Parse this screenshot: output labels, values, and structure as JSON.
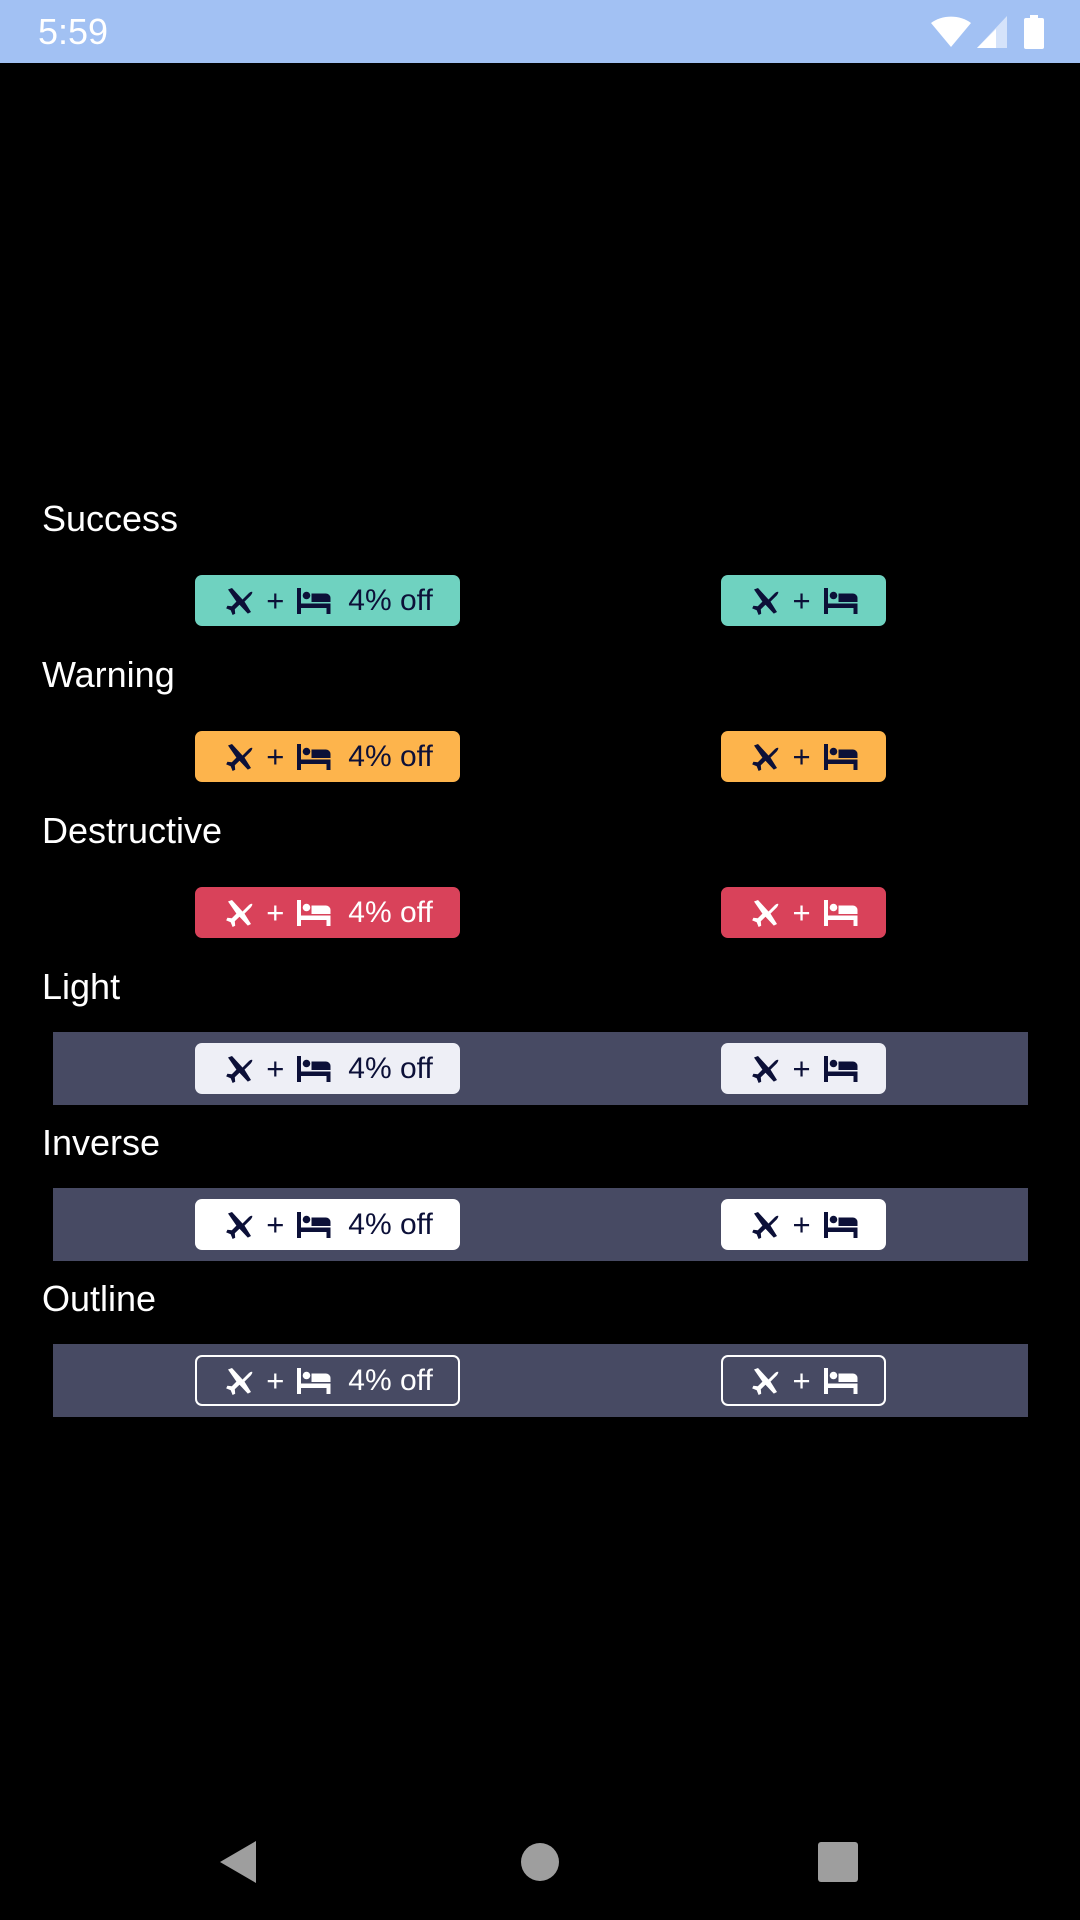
{
  "status_bar": {
    "time": "5:59",
    "background": "#a2c1f3",
    "icons": [
      "wifi-icon",
      "signal-icon",
      "battery-icon"
    ]
  },
  "badge": {
    "plus": "+",
    "discount": "4% off",
    "icons": [
      "plane-icon",
      "bed-icon"
    ]
  },
  "sections": [
    {
      "title": "Success",
      "color": "#6fd2c0"
    },
    {
      "title": "Warning",
      "color": "#fdb44c"
    },
    {
      "title": "Destructive",
      "color": "#d9425a"
    },
    {
      "title": "Light",
      "color": "#eeeff6",
      "band_color": "#474a63"
    },
    {
      "title": "Inverse",
      "color": "#ffffff",
      "band_color": "#474a63"
    },
    {
      "title": "Outline",
      "color": "#ffffff",
      "band_color": "#474a63"
    }
  ],
  "navigation": {
    "icons": [
      "back-icon",
      "home-icon",
      "recents-icon"
    ]
  }
}
